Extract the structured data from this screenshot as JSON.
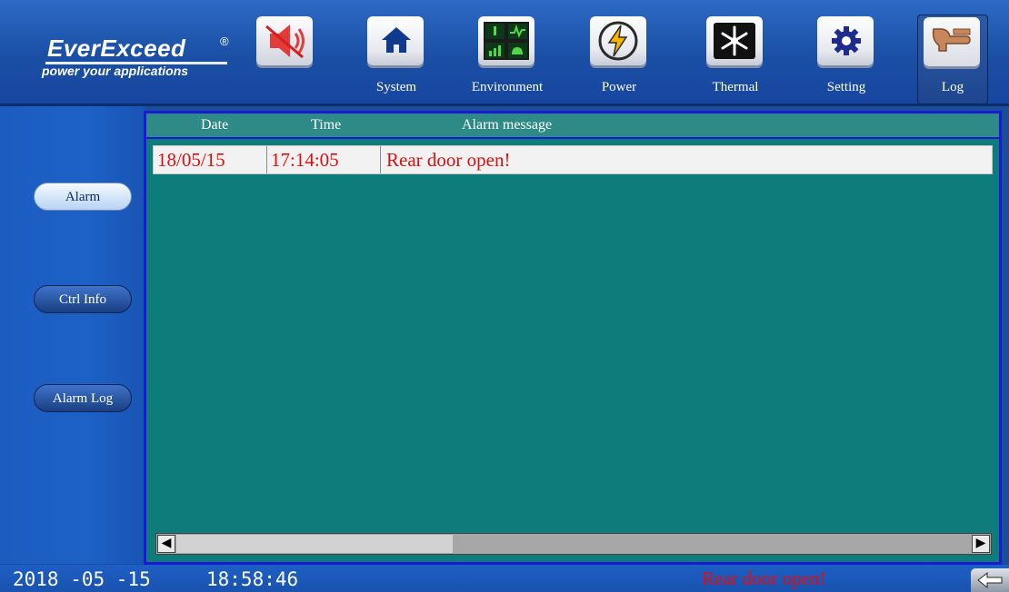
{
  "header": {
    "brand": "EverExceed",
    "registered": "®",
    "tagline": "power your applications",
    "mute_icon": "speaker-muted-icon",
    "nav": [
      {
        "label": "System",
        "icon": "home-icon"
      },
      {
        "label": "Environment",
        "icon": "environment-gauges-icon"
      },
      {
        "label": "Power",
        "icon": "lightning-icon"
      },
      {
        "label": "Thermal",
        "icon": "snowflake-icon"
      },
      {
        "label": "Setting",
        "icon": "gear-icon"
      },
      {
        "label": "Log",
        "icon": "log-hand-icon"
      }
    ],
    "active_nav": "Log"
  },
  "sidebar": {
    "buttons": [
      {
        "label": "Alarm",
        "active": true
      },
      {
        "label": "Ctrl Info",
        "active": false
      },
      {
        "label": "Alarm Log",
        "active": false
      }
    ]
  },
  "table": {
    "columns": [
      "Date",
      "Time",
      "Alarm message"
    ],
    "rows": [
      {
        "date": "18/05/15",
        "time": "17:14:05",
        "message": "Rear door open!"
      }
    ],
    "scroll_left_glyph": "◀",
    "scroll_right_glyph": "▶"
  },
  "status": {
    "date": "2018 -05 -15",
    "time": "18:58:46",
    "alarm": "Rear door open!",
    "back_icon": "back-arrow-icon"
  },
  "colors": {
    "panel": "#0f7c7c",
    "panel_border": "#1a1ad6",
    "alarm_text": "#e30d0d",
    "background": "#1b4e9a"
  }
}
